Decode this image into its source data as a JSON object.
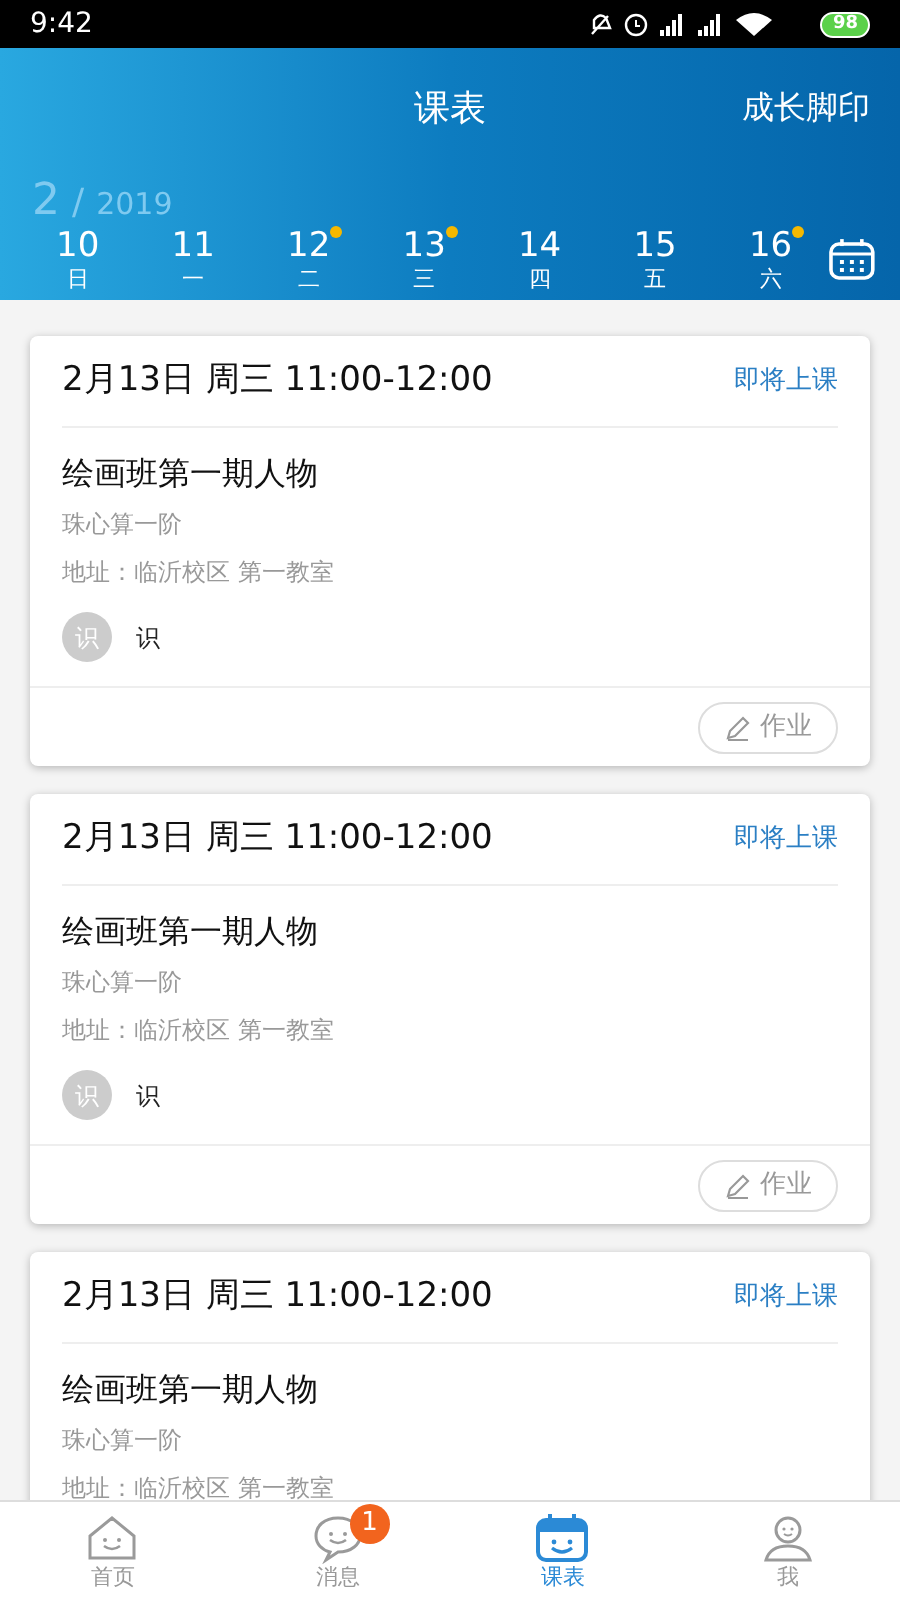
{
  "status_bar": {
    "time": "9:42",
    "battery": "98"
  },
  "header": {
    "title": "课表",
    "action": "成长脚印",
    "month": "2",
    "separator": "/",
    "year": "2019"
  },
  "days": [
    {
      "date": "10",
      "weekday": "日",
      "marked": false
    },
    {
      "date": "11",
      "weekday": "一",
      "marked": false
    },
    {
      "date": "12",
      "weekday": "二",
      "marked": true
    },
    {
      "date": "13",
      "weekday": "三",
      "marked": true
    },
    {
      "date": "14",
      "weekday": "四",
      "marked": false
    },
    {
      "date": "15",
      "weekday": "五",
      "marked": false
    },
    {
      "date": "16",
      "weekday": "六",
      "marked": true
    }
  ],
  "lessons": [
    {
      "time": "2月13日 周三 11:00-12:00",
      "status": "即将上课",
      "title": "绘画班第一期人物",
      "course": "珠心算一阶",
      "address": "地址：临沂校区 第一教室",
      "teacher_avatar": "识",
      "teacher": "识",
      "homework": "作业"
    },
    {
      "time": "2月13日 周三 11:00-12:00",
      "status": "即将上课",
      "title": "绘画班第一期人物",
      "course": "珠心算一阶",
      "address": "地址：临沂校区 第一教室",
      "teacher_avatar": "识",
      "teacher": "识",
      "homework": "作业"
    },
    {
      "time": "2月13日 周三 11:00-12:00",
      "status": "即将上课",
      "title": "绘画班第一期人物",
      "course": "珠心算一阶",
      "address": "地址：临沂校区 第一教室"
    }
  ],
  "tab_bar": [
    {
      "kind": "home",
      "label": "首页",
      "selected": false
    },
    {
      "kind": "messages",
      "label": "消息",
      "selected": false,
      "badge": "1"
    },
    {
      "kind": "schedule",
      "label": "课表",
      "selected": true
    },
    {
      "kind": "me",
      "label": "我",
      "selected": false
    }
  ]
}
